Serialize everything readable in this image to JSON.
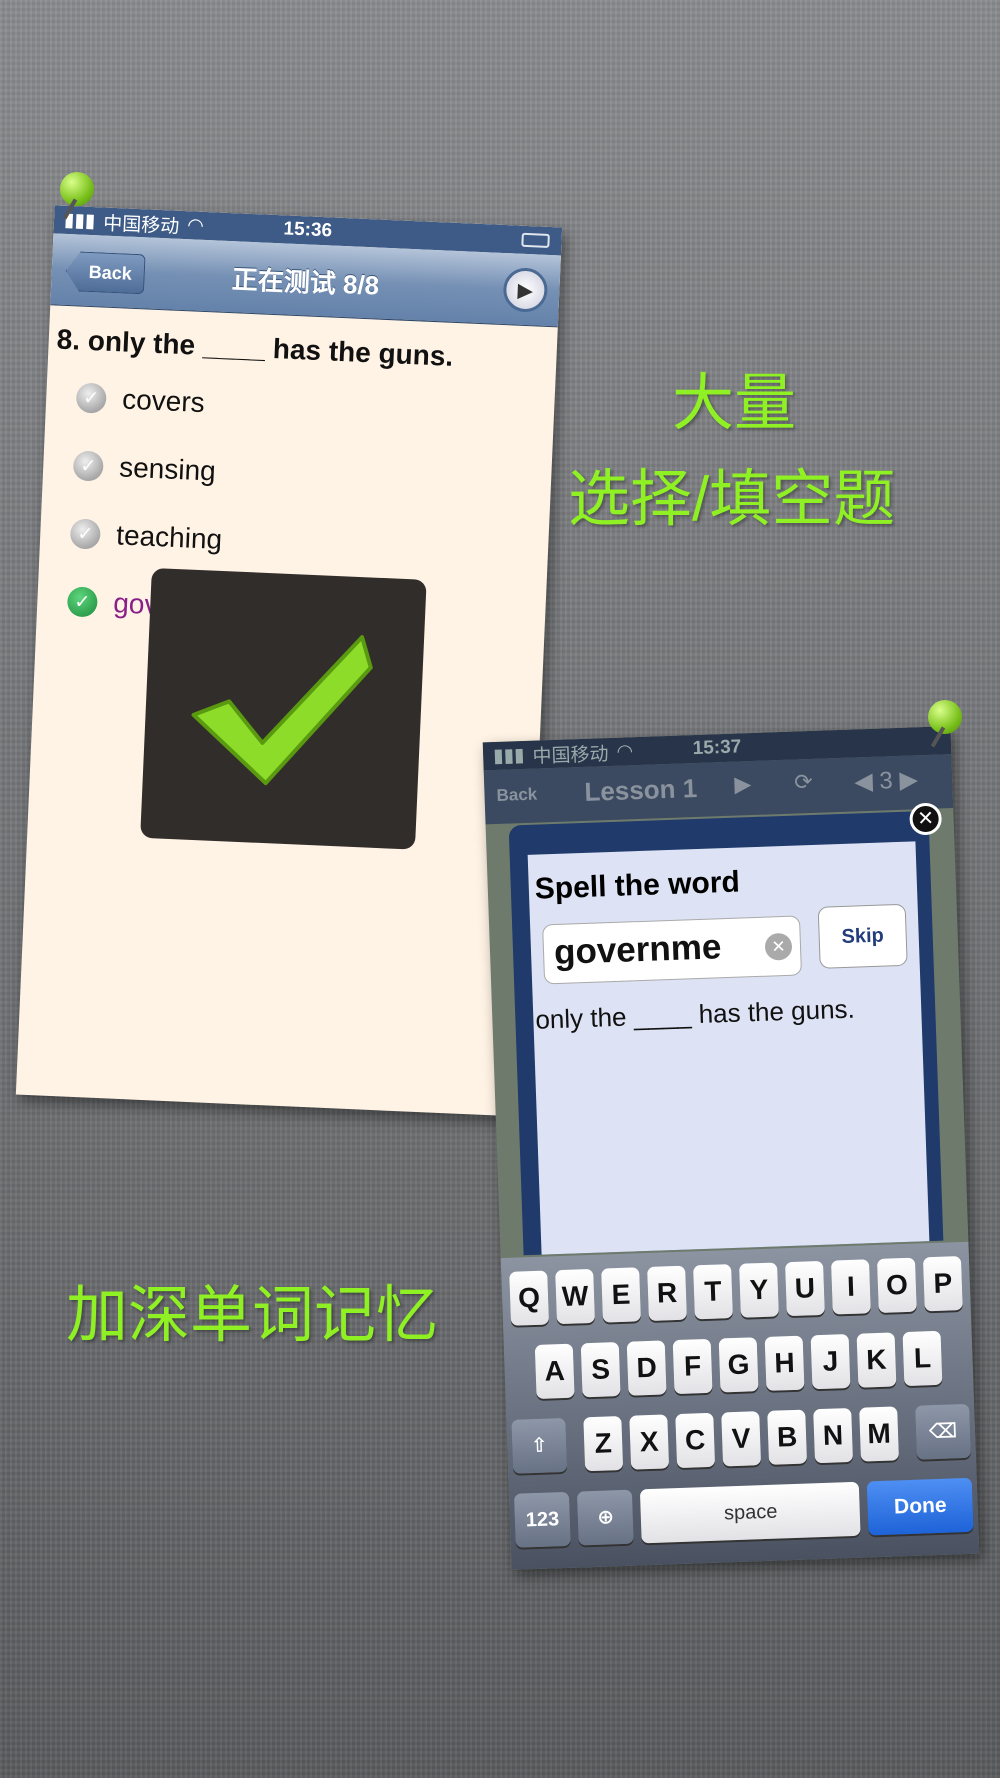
{
  "captions": {
    "line1": "大量",
    "line2": "选择/填空题",
    "line3": "加深单词记忆"
  },
  "quiz_screen": {
    "status": {
      "carrier": "中国移动",
      "time": "15:36"
    },
    "nav": {
      "back": "Back",
      "title": "正在测试 8/8"
    },
    "question": "8. only the ____ has the guns.",
    "options": [
      {
        "label": "covers",
        "selected": false
      },
      {
        "label": "sensing",
        "selected": false
      },
      {
        "label": "teaching",
        "selected": false
      },
      {
        "label": "government",
        "selected": true
      }
    ],
    "colors": {
      "selected_option": "#8a1f8a",
      "check_green": "#8ddc2a"
    }
  },
  "spell_screen": {
    "status": {
      "carrier": "中国移动",
      "time": "15:37"
    },
    "nav": {
      "back": "Back",
      "title": "Lesson 1",
      "page": "3"
    },
    "popup": {
      "title": "Spell the word",
      "input_value": "governme",
      "skip": "Skip",
      "sentence": "only the ____ has the guns."
    },
    "keyboard": {
      "row1": [
        "Q",
        "W",
        "E",
        "R",
        "T",
        "Y",
        "U",
        "I",
        "O",
        "P"
      ],
      "row2": [
        "A",
        "S",
        "D",
        "F",
        "G",
        "H",
        "J",
        "K",
        "L"
      ],
      "row3": [
        "Z",
        "X",
        "C",
        "V",
        "B",
        "N",
        "M"
      ],
      "numbers": "123",
      "space": "space",
      "done": "Done"
    }
  }
}
